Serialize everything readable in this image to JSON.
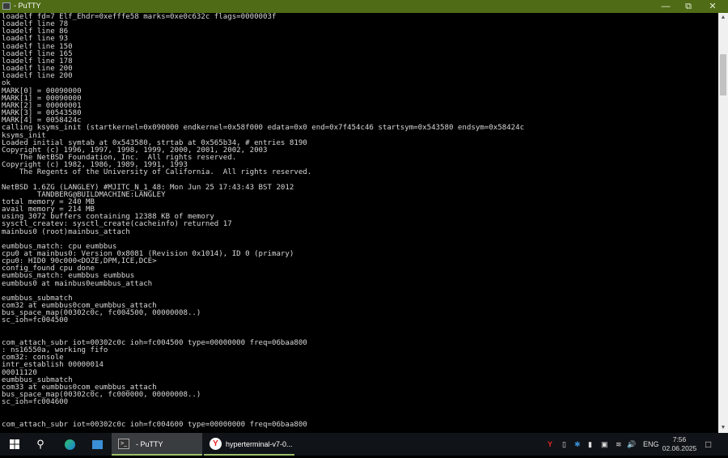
{
  "window": {
    "title": "- PuTTY"
  },
  "terminal": {
    "lines": [
      "loadelf fd=7 Elf_Ehdr=0xefffe58 marks=0xe0c632c flags=0000003f",
      "loadelf line 78",
      "loadelf line 86",
      "loadelf line 93",
      "loadelf line 150",
      "loadelf line 165",
      "loadelf line 178",
      "loadelf line 200",
      "loadelf line 200",
      "ok",
      "MARK[0] = 00090000",
      "MARK[1] = 00090000",
      "MARK[2] = 00000001",
      "MARK[3] = 00543580",
      "MARK[4] = 0058424c",
      "calling ksyms_init (startkernel=0x090000 endkernel=0x58f000 edata=0x0 end=0x7f454c46 startsym=0x543580 endsym=0x58424c",
      "ksyms_init",
      "Loaded initial symtab at 0x543580, strtab at 0x565b34, # entries 8190",
      "Copyright (c) 1996, 1997, 1998, 1999, 2000, 2001, 2002, 2003",
      "    The NetBSD Foundation, Inc.  All rights reserved.",
      "Copyright (c) 1982, 1986, 1989, 1991, 1993",
      "    The Regents of the University of California.  All rights reserved.",
      "",
      "NetBSD 1.6ZG (LANGLEY) #MJITC_N_1_48: Mon Jun 25 17:43:43 BST 2012",
      "        TANDBERG@BUILDMACHINE:LANGLEY",
      "total memory = 240 MB",
      "avail memory = 214 MB",
      "using 3072 buffers containing 12388 KB of memory",
      "sysctl_createv: sysctl_create(cacheinfo) returned 17",
      "mainbus0 (root)mainbus_attach",
      "",
      "eumbbus_match: cpu eumbbus",
      "cpu0 at mainbus0: Version 0x8081 (Revision 0x1014), ID 0 (primary)",
      "cpu0: HID0 90c000<DOZE,DPM,ICE,DCE>",
      "config_found cpu done",
      "eumbbus_match: eumbbus eumbbus",
      "eumbbus0 at mainbus0eumbbus_attach",
      "",
      "eumbbus_submatch",
      "com32 at eumbbus0com_eumbbus_attach",
      "bus_space_map(00302c0c, fc004500, 00000008..)",
      "sc_ioh=fc004500",
      "",
      "",
      "com_attach_subr iot=00302c0c ioh=fc004500 type=00000000 freq=06baa800",
      ": ns16550a, working fifo",
      "com32: console",
      "intr_establish 00000014",
      "00011120",
      "eumbbus_submatch",
      "com33 at eumbbus0com_eumbbus_attach",
      "bus_space_map(00302c0c, fc000000, 00000008..)",
      "sc_ioh=fc004600",
      "",
      "",
      "com_attach_subr iot=00302c0c ioh=fc004600 type=00000000 freq=06baa800"
    ]
  },
  "taskbar": {
    "tasks": [
      {
        "label": "- PuTTY"
      },
      {
        "label": "hyperterminal-v7-0..."
      }
    ],
    "language": "ENG",
    "time": "7:56",
    "date": "02.06.2025"
  }
}
